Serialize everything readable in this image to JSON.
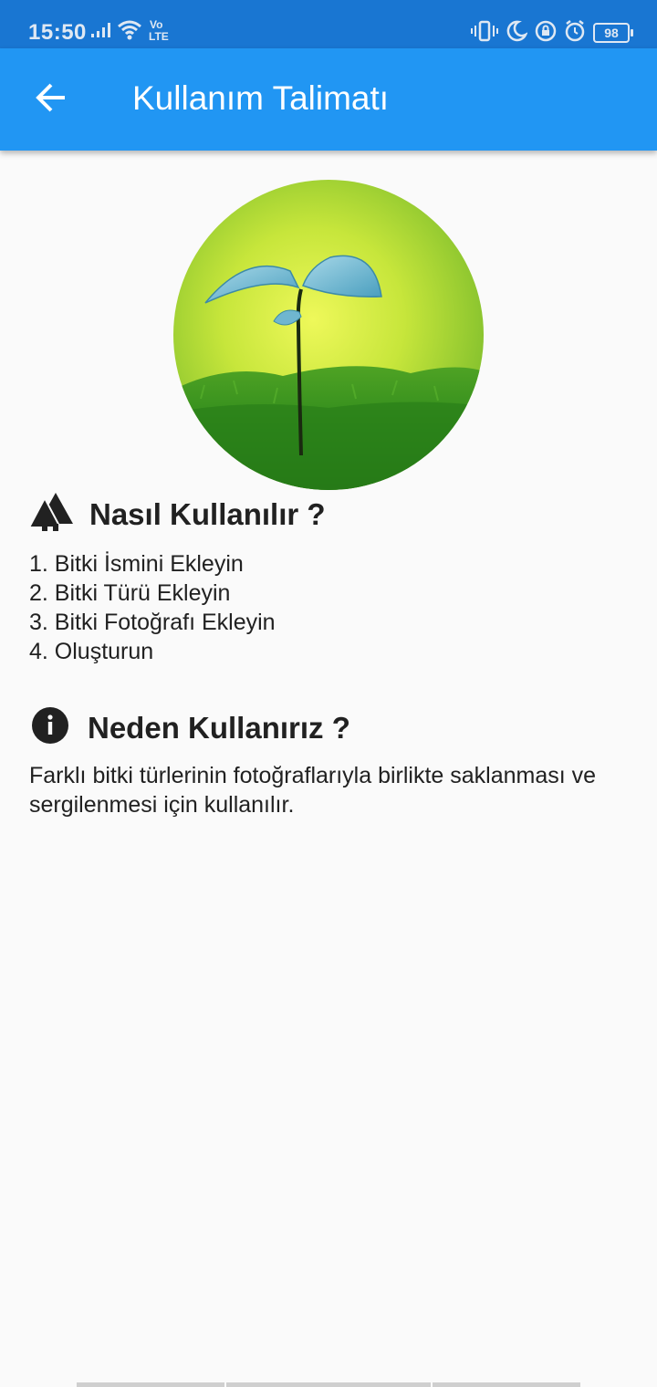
{
  "status_bar": {
    "time": "15:50",
    "network": "Vo LTE",
    "battery": "98",
    "colors": {
      "background": "#1976d2",
      "foreground": "#dfe8f3"
    },
    "icons": [
      "signal-icon",
      "wifi-icon",
      "volte-icon",
      "vibrate-icon",
      "moon-icon",
      "lock-rotation-icon",
      "alarm-icon",
      "battery-icon"
    ]
  },
  "app_bar": {
    "title": "Kullanım Talimatı",
    "back_icon": "arrow-back-icon",
    "color": "#2196f3"
  },
  "hero": {
    "image": "plant-sprout-photo"
  },
  "how_to": {
    "icon": "trees-icon",
    "title": "Nasıl Kullanılır ?",
    "steps": [
      "1. Bitki İsmini Ekleyin",
      "2. Bitki Türü Ekleyin",
      "3. Bitki Fotoğrafı Ekleyin",
      "4. Oluşturun"
    ]
  },
  "why": {
    "icon": "info-icon",
    "title": "Neden Kullanırız ?",
    "text": "Farklı bitki türlerinin fotoğraflarıyla birlikte saklanması ve sergilenmesi için kullanılır."
  }
}
